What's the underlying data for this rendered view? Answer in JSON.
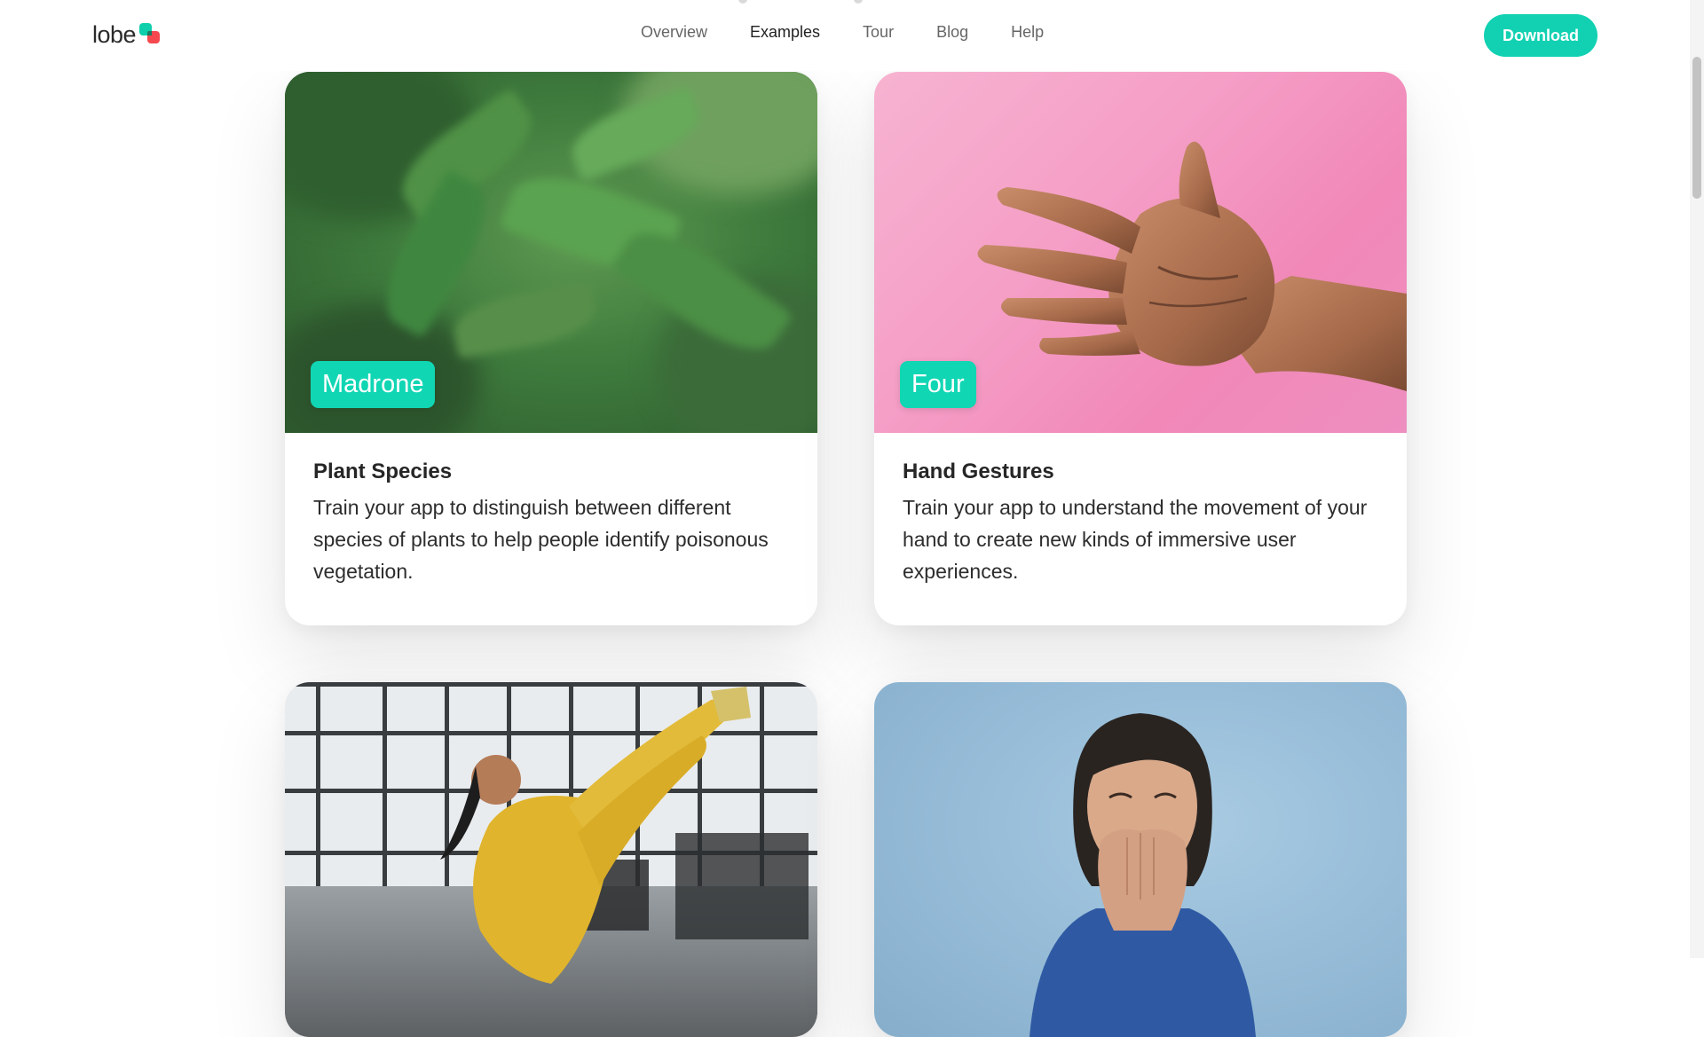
{
  "brand": {
    "name": "lobe",
    "colors": {
      "accent": "#11d1b2",
      "logo_green": "#0ecfab",
      "logo_red": "#f5484f"
    }
  },
  "nav": {
    "items": [
      {
        "label": "Overview",
        "active": false
      },
      {
        "label": "Examples",
        "active": true
      },
      {
        "label": "Tour",
        "active": false
      },
      {
        "label": "Blog",
        "active": false
      },
      {
        "label": "Help",
        "active": false
      }
    ],
    "download_label": "Download"
  },
  "cards": [
    {
      "image": "plant-leaves-photo",
      "tag": "Madrone",
      "title": "Plant Species",
      "description": "Train your app to distinguish between different species of plants to help people identify poisonous vegetation."
    },
    {
      "image": "hand-gesture-photo",
      "tag": "Four",
      "title": "Hand Gestures",
      "description": "Train your app to understand the movement of your hand to create new kinds of immersive user experiences."
    },
    {
      "image": "gym-exercise-photo"
    },
    {
      "image": "laughing-woman-photo"
    }
  ]
}
